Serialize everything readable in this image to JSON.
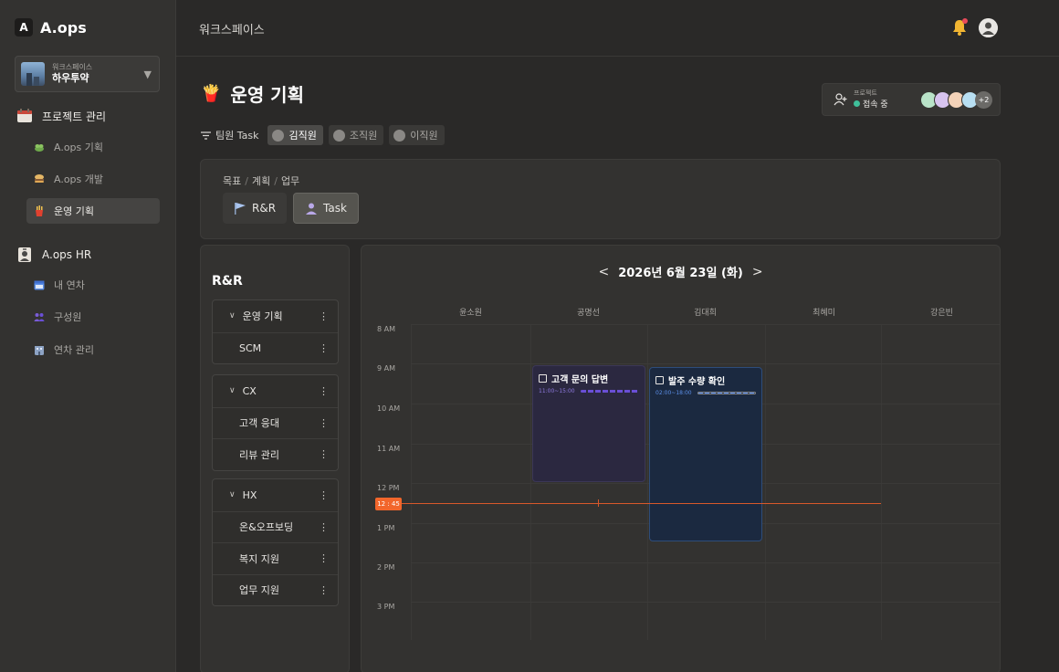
{
  "app": {
    "logo_mark": "A",
    "name": "A.ops"
  },
  "workspace": {
    "sub": "워크스페이스",
    "name": "하우투약"
  },
  "sidebar": {
    "groups": [
      {
        "label": "프로젝트 관리",
        "items": [
          "A.ops 기획",
          "A.ops 개발",
          "운영 기획"
        ]
      },
      {
        "label": "A.ops HR",
        "items": [
          "내 연차",
          "구성원",
          "연차 관리"
        ]
      }
    ],
    "active_item": "운영 기획"
  },
  "header": {
    "workspace_label": "워크스페이스"
  },
  "page": {
    "title": "운영 기획",
    "title_icon": "🍟"
  },
  "presence": {
    "sub": "프로젝트",
    "status": "접속 중",
    "more": "+2"
  },
  "filter": {
    "label": "팀원 Task",
    "members": [
      "김직원",
      "조직원",
      "이직원"
    ],
    "active": "김직원"
  },
  "breadcrumb": [
    "목표",
    "계획",
    "업무"
  ],
  "view_buttons": [
    {
      "label": "R&R"
    },
    {
      "label": "Task"
    }
  ],
  "rr": {
    "title": "R&R",
    "groups": [
      {
        "name": "운영 기획",
        "items": [
          "SCM"
        ]
      },
      {
        "name": "CX",
        "items": [
          "고객 응대",
          "리뷰 관리"
        ]
      },
      {
        "name": "HX",
        "items": [
          "온&오프보딩",
          "복지 지원",
          "업무 지원"
        ]
      }
    ]
  },
  "calendar": {
    "prev": "<",
    "date": "2026년 6월 23일 (화)",
    "next": ">",
    "columns": [
      "윤소원",
      "공명선",
      "김대희",
      "최혜미",
      "강은빈"
    ],
    "times": [
      "8 AM",
      "9 AM",
      "10 AM",
      "11 AM",
      "12 PM",
      "1 PM",
      "2 PM",
      "3 PM"
    ],
    "now": "12 : 45",
    "events": [
      {
        "title": "고객 문의 답변",
        "time": "11:00~15:00",
        "bar_color": "#6a4fd6",
        "bg": "#2b2840",
        "time_color": "#8f7ae0"
      },
      {
        "title": "발주 수량 확인",
        "time": "02:00~18:00",
        "bar_color": "#3f7ae8",
        "bg": "#1b2940",
        "time_color": "#5b8fe8"
      }
    ]
  },
  "colors": {
    "accent_now": "#f2662b",
    "presence_online": "#3fbf9a",
    "bell": "#f2b632"
  }
}
